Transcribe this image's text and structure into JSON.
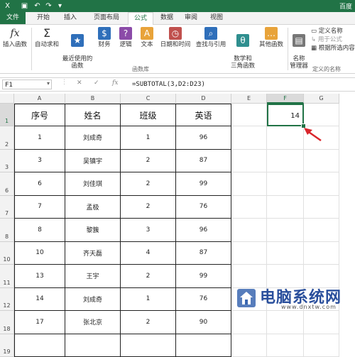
{
  "titlebar": {
    "right_text": "百度"
  },
  "tabs": [
    {
      "label": "文件",
      "kind": "file"
    },
    {
      "label": "开始"
    },
    {
      "label": "插入"
    },
    {
      "label": "页面布局"
    },
    {
      "label": "公式",
      "kind": "active"
    },
    {
      "label": "数据"
    },
    {
      "label": "审阅"
    },
    {
      "label": "视图"
    }
  ],
  "ribbon": {
    "buttons": [
      {
        "label": "插入函数",
        "icon": "fx"
      },
      {
        "label": "自动求和",
        "icon": "Σ"
      },
      {
        "label": "最近使用的\n函数",
        "icon": "★"
      },
      {
        "label": "财务",
        "icon": "$"
      },
      {
        "label": "逻辑",
        "icon": "?"
      },
      {
        "label": "文本",
        "icon": "A"
      },
      {
        "label": "日期和时间",
        "icon": "◷"
      },
      {
        "label": "查找与引用",
        "icon": "⌕"
      },
      {
        "label": "数学和\n三角函数",
        "icon": "θ"
      },
      {
        "label": "其他函数",
        "icon": "…"
      },
      {
        "label": "名称\n管理器",
        "icon": "▤"
      }
    ],
    "group_label": "函数库",
    "names": {
      "define": "定义名称",
      "use_in_formula": "用于公式",
      "create_from_selection": "根据所选内容创建",
      "group_label": "定义的名称"
    }
  },
  "formula_bar": {
    "name_box": "F1",
    "formula": "=SUBTOTAL(3,D2:D23)"
  },
  "sheet": {
    "columns": [
      "A",
      "B",
      "C",
      "D",
      "E",
      "F",
      "G"
    ],
    "rows": [
      "1",
      "2",
      "3",
      "6",
      "7",
      "8",
      "10",
      "11",
      "12",
      "18",
      "19"
    ],
    "headers": [
      "序号",
      "姓名",
      "班级",
      "英语"
    ],
    "data": [
      [
        "1",
        "刘成奇",
        "1",
        "96"
      ],
      [
        "3",
        "吴镇宇",
        "2",
        "87"
      ],
      [
        "6",
        "刘佳琪",
        "2",
        "99"
      ],
      [
        "7",
        "孟极",
        "2",
        "76"
      ],
      [
        "8",
        "黎簇",
        "3",
        "96"
      ],
      [
        "10",
        "齐天磊",
        "4",
        "87"
      ],
      [
        "13",
        "王宇",
        "2",
        "99"
      ],
      [
        "14",
        "刘成奇",
        "1",
        "76"
      ],
      [
        "17",
        "张北京",
        "2",
        "90"
      ]
    ],
    "f1_value": "14"
  },
  "watermark": {
    "text": "电脑系统网",
    "url": "www.dnxtw.com"
  },
  "colors": {
    "excel_green": "#217346",
    "arrow_red": "#d9262c"
  }
}
